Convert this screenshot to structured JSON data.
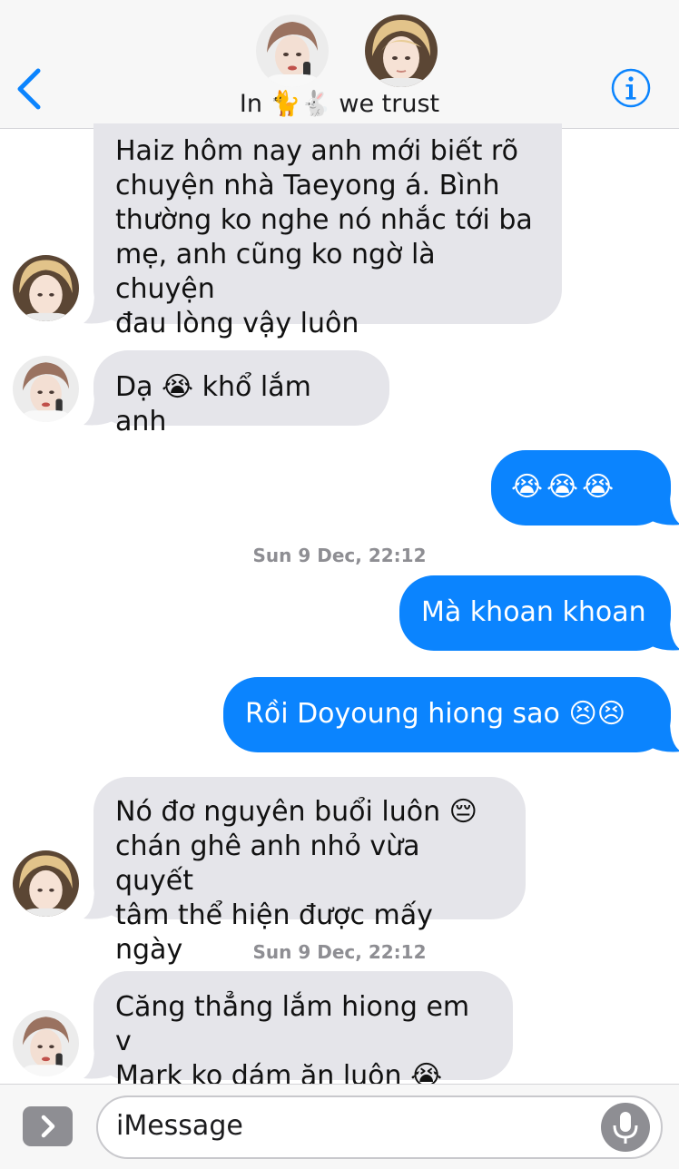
{
  "header": {
    "title_prefix": "In",
    "title_emoji": "🐈🐇",
    "title_suffix": "we trust",
    "back_icon": "chevron-left-icon",
    "info_icon": "info-circle-icon",
    "accent_color": "#0b84fe"
  },
  "messages": [
    {
      "sender": "incoming",
      "avatar": "avatar-b",
      "text": "Haiz hôm nay anh mới biết rõ\nchuyện nhà Taeyong á. Bình\nthường ko nghe nó nhắc tới ba\nmẹ, anh cũng ko ngờ là chuyện\nđau lòng vậy luôn"
    },
    {
      "sender": "incoming",
      "avatar": "avatar-a",
      "text": "Dạ 😭 khổ lắm anh"
    },
    {
      "sender": "outgoing",
      "text": "😭😭😭"
    },
    {
      "sender": "outgoing",
      "text": "Mà khoan khoan"
    },
    {
      "sender": "outgoing",
      "text": "Rồi Doyoung hiong sao 😣😣"
    },
    {
      "sender": "incoming",
      "avatar": "avatar-b",
      "text": "Nó đơ nguyên buổi luôn  😔\nchán ghê anh nhỏ vừa quyết\ntâm thể hiện được mấy ngày"
    },
    {
      "sender": "incoming",
      "avatar": "avatar-a",
      "text": "Căng thẳng lắm hiong em v\nMark ko dám ăn luôn 😭"
    }
  ],
  "timestamps": [
    "Sun 9 Dec, 22:12",
    "Sun 9 Dec, 22:12"
  ],
  "composer": {
    "placeholder": "iMessage",
    "expand_icon": "chevron-right-icon",
    "mic_icon": "microphone-icon"
  },
  "colors": {
    "incoming_bubble": "#e5e5ea",
    "outgoing_bubble": "#0b84fe",
    "timestamp": "#8e8e93"
  }
}
